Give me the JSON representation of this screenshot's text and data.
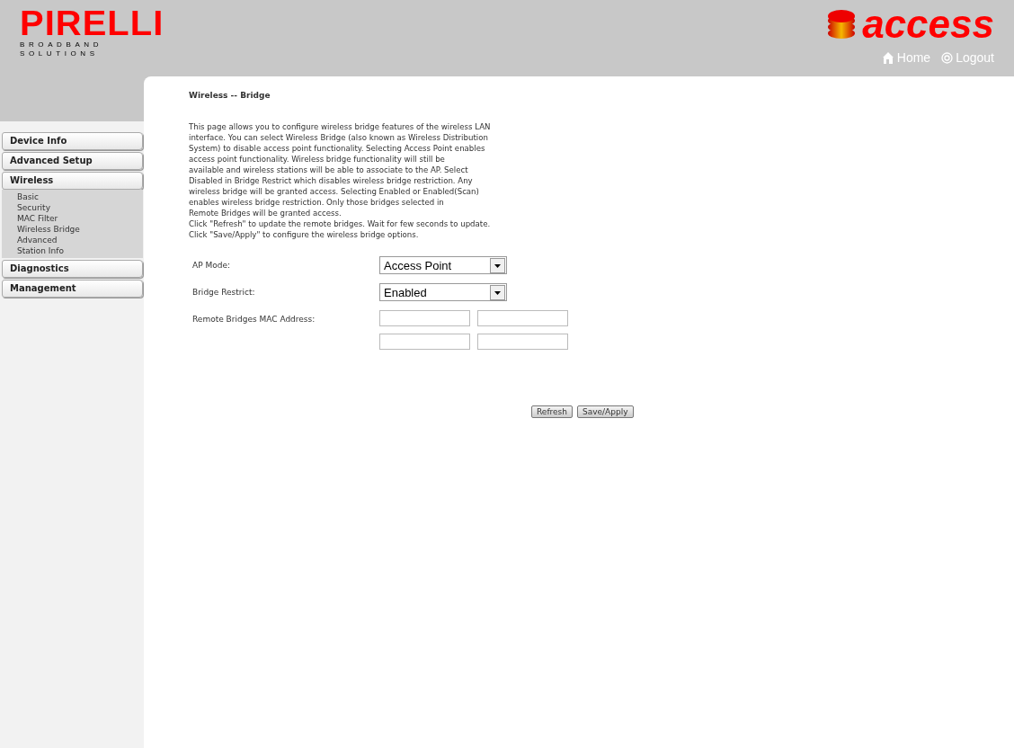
{
  "header": {
    "brand": "PIRELLI",
    "tagline_lines": [
      "BROADBAND",
      "SOLUTIONS"
    ],
    "product": "access",
    "links": [
      {
        "kind": "home",
        "label": "Home"
      },
      {
        "kind": "logout",
        "label": "Logout"
      }
    ]
  },
  "sidebar": {
    "items": [
      {
        "label": "Device Info"
      },
      {
        "label": "Advanced Setup"
      },
      {
        "label": "Wireless",
        "children": [
          {
            "label": "Basic"
          },
          {
            "label": "Security"
          },
          {
            "label": "MAC Filter"
          },
          {
            "label": "Wireless Bridge"
          },
          {
            "label": "Advanced"
          },
          {
            "label": "Station Info"
          }
        ]
      },
      {
        "label": "Diagnostics"
      },
      {
        "label": "Management"
      }
    ]
  },
  "page": {
    "title": "Wireless -- Bridge",
    "description_lines": [
      "This page allows you to configure wireless bridge features of the wireless LAN",
      "interface. You can select Wireless Bridge (also known as Wireless Distribution",
      "System) to disable access point functionality. Selecting Access Point enables",
      "access point functionality. Wireless bridge functionality will still be",
      "available and wireless stations will be able to associate to the AP. Select",
      "Disabled in Bridge Restrict which disables wireless bridge restriction. Any",
      "wireless bridge will be granted access. Selecting Enabled or Enabled(Scan)",
      "enables wireless bridge restriction. Only those bridges selected in",
      "Remote Bridges will be granted access.",
      "Click \"Refresh\" to update the remote bridges. Wait for few seconds to update.",
      "Click \"Save/Apply\" to configure the wireless bridge options."
    ],
    "fields": [
      {
        "kind": "select",
        "label": "AP Mode:",
        "value": "Access Point"
      },
      {
        "kind": "select",
        "label": "Bridge Restrict:",
        "value": "Enabled"
      },
      {
        "kind": "mac",
        "label": "Remote Bridges MAC Address:"
      }
    ],
    "buttons": [
      "Refresh",
      "Save/Apply"
    ]
  }
}
